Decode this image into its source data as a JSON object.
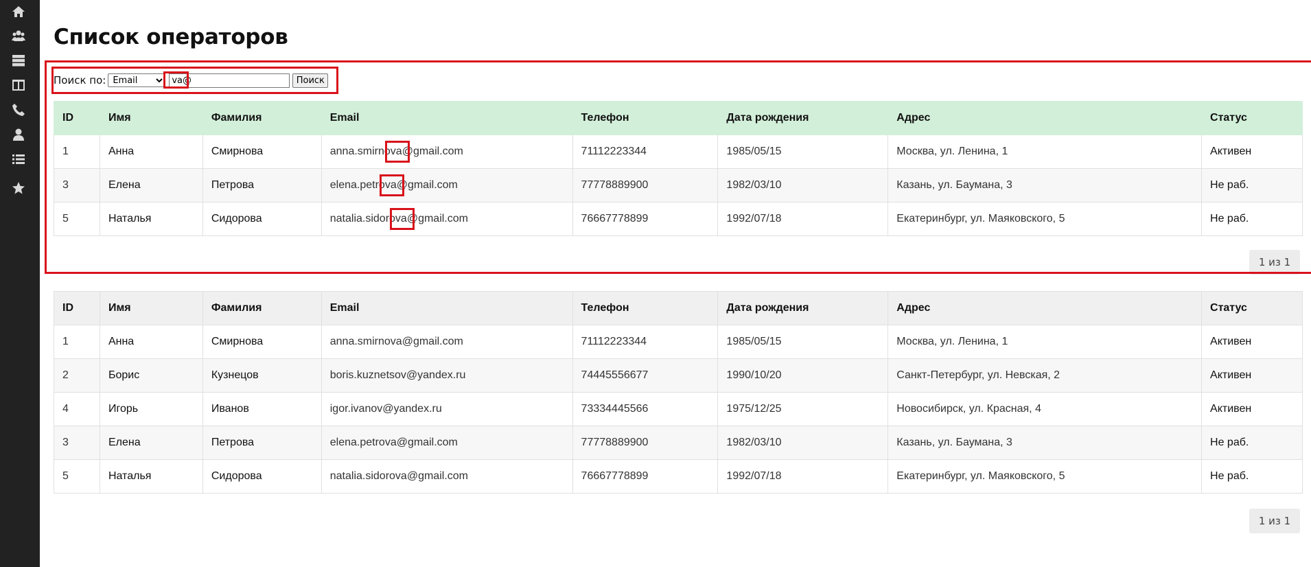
{
  "sidebar": {
    "icons": [
      "home-icon",
      "users-icon",
      "server-icon",
      "columns-icon",
      "phone-icon",
      "user-icon",
      "list-icon",
      "star-icon"
    ]
  },
  "page": {
    "title": "Список операторов"
  },
  "search": {
    "label": "Поиск по:",
    "field_selected": "Email",
    "value": "va@",
    "button_label": "Поиск"
  },
  "columns": [
    "ID",
    "Имя",
    "Фамилия",
    "Email",
    "Телефон",
    "Дата рождения",
    "Адрес",
    "Статус"
  ],
  "results_table": {
    "rows": [
      [
        "1",
        "Анна",
        "Смирнова",
        "anna.smirnova@gmail.com",
        "71112223344",
        "1985/05/15",
        "Москва, ул. Ленина, 1",
        "Активен"
      ],
      [
        "3",
        "Елена",
        "Петрова",
        "elena.petrova@gmail.com",
        "77778889900",
        "1982/03/10",
        "Казань, ул. Баумана, 3",
        "Не раб."
      ],
      [
        "5",
        "Наталья",
        "Сидорова",
        "natalia.sidorova@gmail.com",
        "76667778899",
        "1992/07/18",
        "Екатеринбург, ул. Маяковского, 5",
        "Не раб."
      ]
    ],
    "pager": "1 из 1"
  },
  "all_table": {
    "rows": [
      [
        "1",
        "Анна",
        "Смирнова",
        "anna.smirnova@gmail.com",
        "71112223344",
        "1985/05/15",
        "Москва, ул. Ленина, 1",
        "Активен"
      ],
      [
        "2",
        "Борис",
        "Кузнецов",
        "boris.kuznetsov@yandex.ru",
        "74445556677",
        "1990/10/20",
        "Санкт-Петербург, ул. Невская, 2",
        "Активен"
      ],
      [
        "4",
        "Игорь",
        "Иванов",
        "igor.ivanov@yandex.ru",
        "73334445566",
        "1975/12/25",
        "Новосибирск, ул. Красная, 4",
        "Активен"
      ],
      [
        "3",
        "Елена",
        "Петрова",
        "elena.petrova@gmail.com",
        "77778889900",
        "1982/03/10",
        "Казань, ул. Баумана, 3",
        "Не раб."
      ],
      [
        "5",
        "Наталья",
        "Сидорова",
        "natalia.sidorova@gmail.com",
        "76667778899",
        "1992/07/18",
        "Екатеринбург, ул. Маяковского, 5",
        "Не раб."
      ]
    ],
    "pager": "1 из 1"
  },
  "colors": {
    "sidebar_bg": "#222222",
    "highlight": "#d8121b",
    "results_header_bg": "#d2efd9",
    "table_header_bg": "#f0f0f0"
  }
}
